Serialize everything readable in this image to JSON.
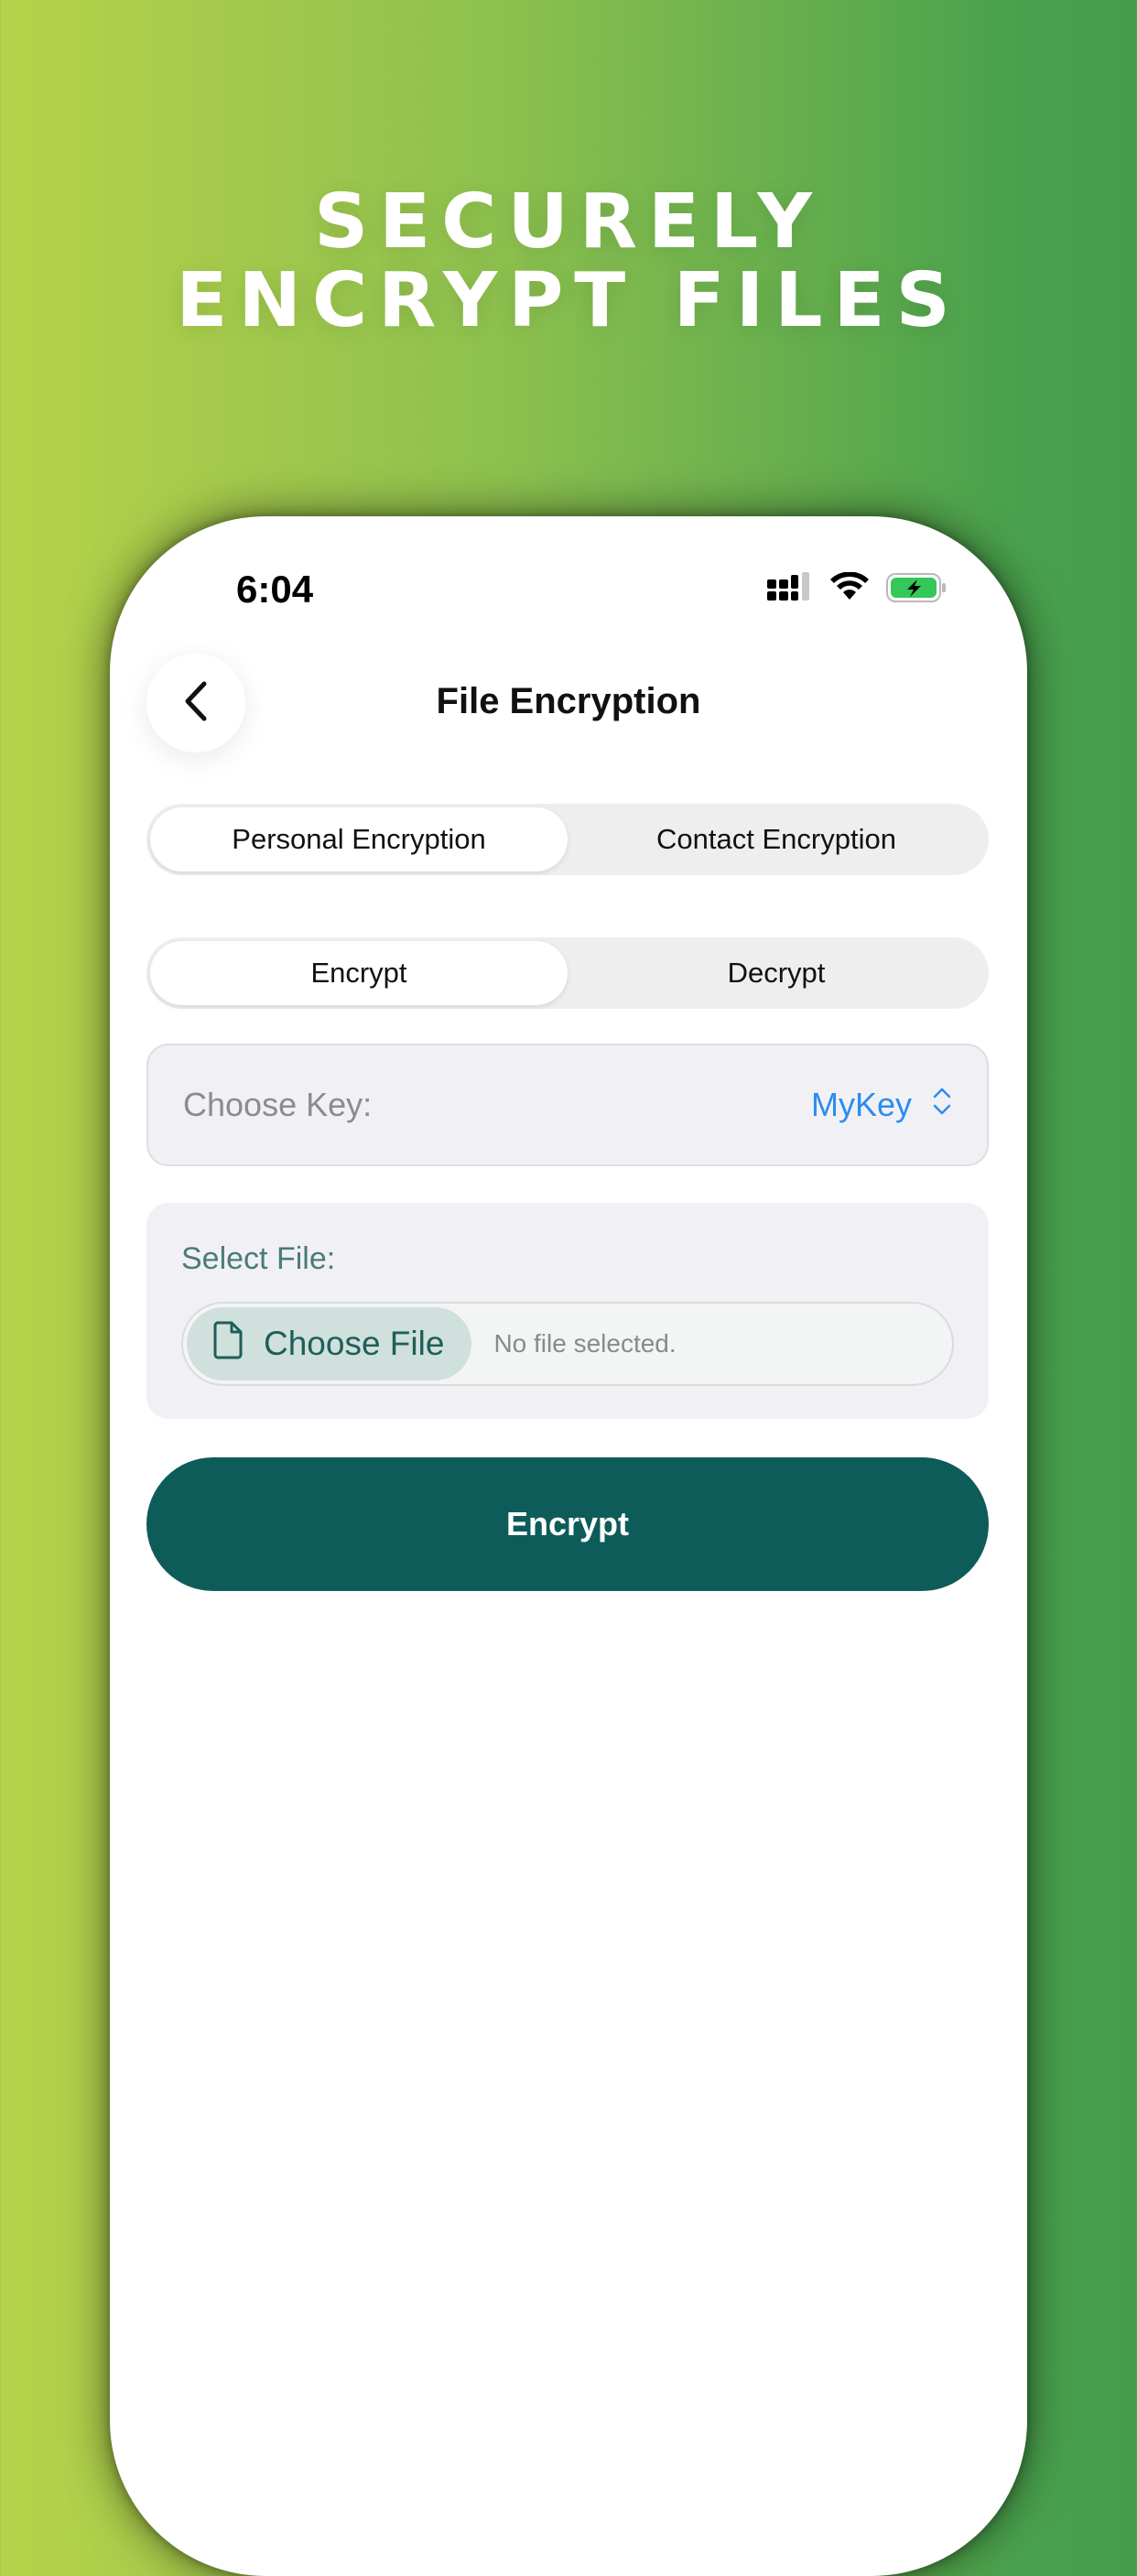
{
  "promo": {
    "headline_line1": "SECURELY",
    "headline_line2": "ENCRYPT FILES"
  },
  "status_bar": {
    "time": "6:04",
    "icons": [
      "cellular-signal-icon",
      "wifi-icon",
      "battery-charging-icon"
    ]
  },
  "nav": {
    "back_icon": "chevron-left-icon",
    "title": "File Encryption"
  },
  "mode_tabs": {
    "items": [
      {
        "label": "Personal Encryption",
        "selected": true
      },
      {
        "label": "Contact Encryption",
        "selected": false
      }
    ]
  },
  "action_tabs": {
    "items": [
      {
        "label": "Encrypt",
        "selected": true
      },
      {
        "label": "Decrypt",
        "selected": false
      }
    ]
  },
  "key_picker": {
    "label": "Choose Key:",
    "value": "MyKey",
    "icon": "chevron-up-down-icon"
  },
  "file_select": {
    "label": "Select File:",
    "button_label": "Choose File",
    "button_icon": "document-icon",
    "status": "No file selected."
  },
  "primary_button": {
    "label": "Encrypt"
  },
  "colors": {
    "background_left": "#b7d24a",
    "background_right": "#449d4c",
    "primary": "#0e5c5a",
    "accent_blue": "#2c8cf0",
    "battery_green": "#34c759",
    "chip_bg": "#cfe0dd"
  }
}
